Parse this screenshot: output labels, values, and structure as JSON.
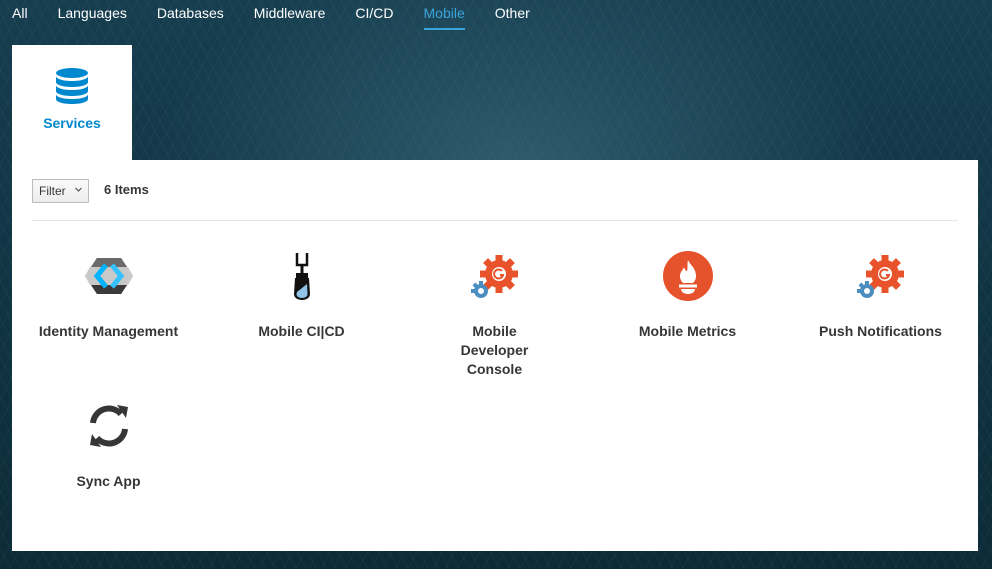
{
  "nav": {
    "tabs": [
      {
        "label": "All"
      },
      {
        "label": "Languages"
      },
      {
        "label": "Databases"
      },
      {
        "label": "Middleware"
      },
      {
        "label": "CI/CD"
      },
      {
        "label": "Mobile",
        "active": true
      },
      {
        "label": "Other"
      }
    ]
  },
  "services_tile": {
    "label": "Services",
    "icon": "database-icon"
  },
  "toolbar": {
    "filter_label": "Filter",
    "item_count": "6 Items"
  },
  "items": [
    {
      "title": "Identity Management",
      "icon": "keycloak-icon"
    },
    {
      "title": "Mobile CI|CD",
      "icon": "jenkins-icon"
    },
    {
      "title": "Mobile Developer Console",
      "icon": "aerogear-icon"
    },
    {
      "title": "Mobile Metrics",
      "icon": "prometheus-icon"
    },
    {
      "title": "Push Notifications",
      "icon": "aerogear-icon"
    },
    {
      "title": "Sync App",
      "icon": "sync-icon"
    }
  ],
  "colors": {
    "accent": "#39a5dc",
    "link": "#0088ce",
    "aerogear_orange": "#e8532b",
    "aerogear_blue": "#4a8ec2",
    "prometheus_orange": "#e6522c"
  }
}
